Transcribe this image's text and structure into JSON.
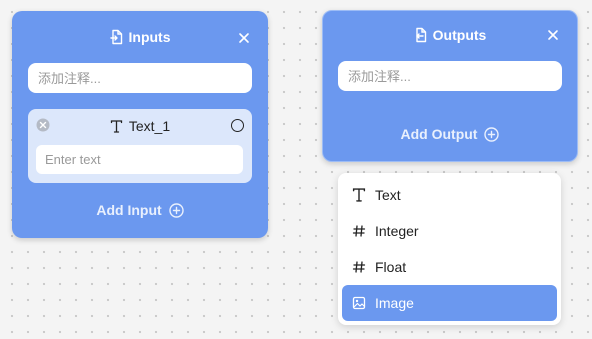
{
  "inputs_node": {
    "title": "Inputs",
    "comment_placeholder": "添加注释...",
    "input_item": {
      "name": "Text_1",
      "placeholder": "Enter text"
    },
    "add_label": "Add Input"
  },
  "outputs_node": {
    "title": "Outputs",
    "comment_placeholder": "添加注释...",
    "add_label": "Add Output"
  },
  "type_menu": {
    "items": [
      {
        "label": "Text",
        "icon": "text-type-icon"
      },
      {
        "label": "Integer",
        "icon": "hash-icon"
      },
      {
        "label": "Float",
        "icon": "hash-icon"
      },
      {
        "label": "Image",
        "icon": "image-icon"
      }
    ],
    "selected": "Image"
  },
  "colors": {
    "node": "#6b98ef",
    "card": "#dce7fb",
    "menu_selected": "#6b98ef"
  }
}
